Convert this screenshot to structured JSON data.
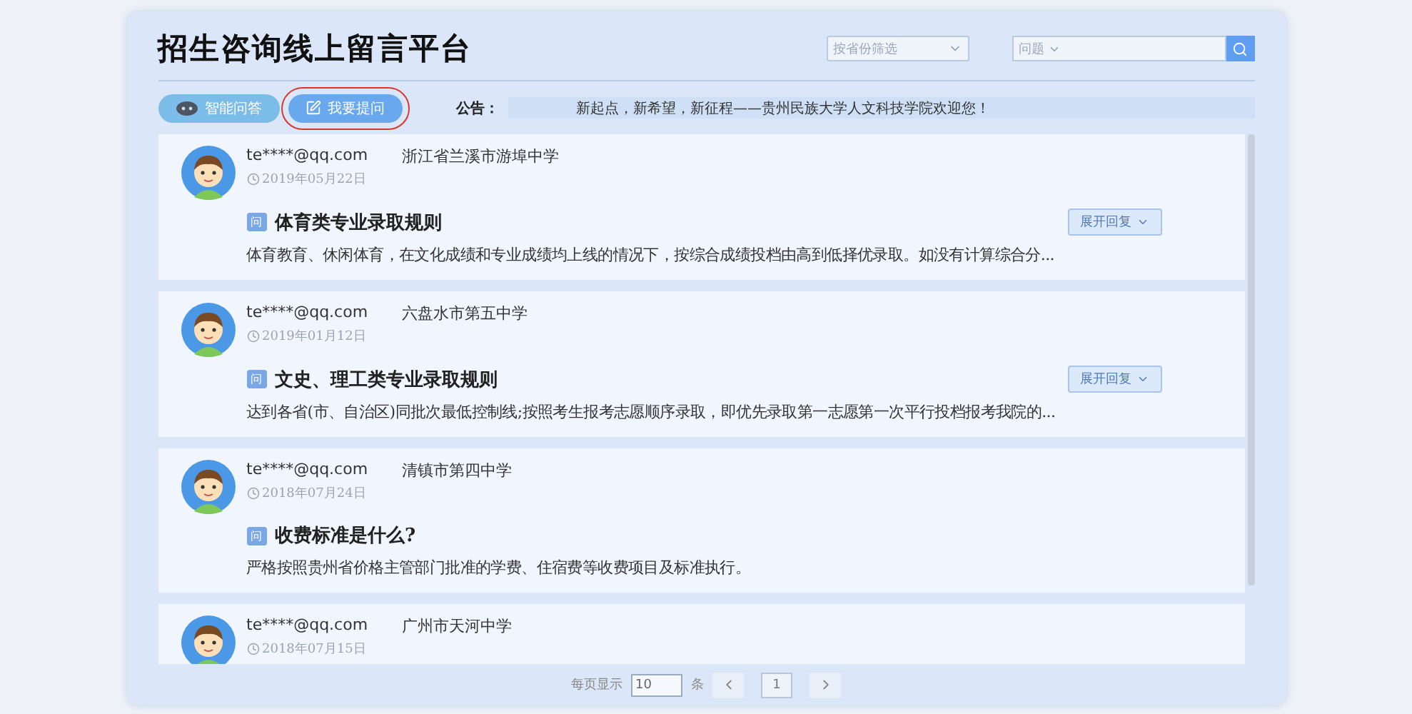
{
  "header": {
    "title": "招生咨询线上留言平台",
    "province_filter": {
      "placeholder": "按省份筛选"
    },
    "search": {
      "placeholder": "问题"
    }
  },
  "actions": [
    {
      "label": "智能问答",
      "selected": false
    },
    {
      "label": "我要提问",
      "selected": true
    }
  ],
  "notice": {
    "label": "公告：",
    "text": "新起点，新希望，新征程——贵州民族大学人文科技学院欢迎您！"
  },
  "posts": [
    {
      "email": "te****@qq.com",
      "school": "浙江省兰溪市游埠中学",
      "date": "2019年05月22日",
      "tag": "问",
      "question": "体育类专业录取规则",
      "answer": "体育教育、休闲体育，在文化成绩和专业成绩均上线的情况下，按综合成绩投档由高到低择优录取。如没有计算综合分...",
      "expand_label": "展开回复"
    },
    {
      "email": "te****@qq.com",
      "school": "六盘水市第五中学",
      "date": "2019年01月12日",
      "tag": "问",
      "question": "文史、理工类专业录取规则",
      "answer": "达到各省(市、自治区)同批次最低控制线;按照考生报考志愿顺序录取，即优先录取第一志愿第一次平行投档报考我院的...",
      "expand_label": "展开回复"
    },
    {
      "email": "te****@qq.com",
      "school": "清镇市第四中学",
      "date": "2018年07月24日",
      "tag": "问",
      "question": "收费标准是什么?",
      "answer": "严格按照贵州省价格主管部门批准的学费、住宿费等收费项目及标准执行。"
    },
    {
      "email": "te****@qq.com",
      "school": "广州市天河中学",
      "date": "2018年07月15日"
    }
  ],
  "pagination": {
    "per_page_label": "每页显示",
    "per_page_value": "10",
    "unit": "条",
    "page": "1"
  }
}
